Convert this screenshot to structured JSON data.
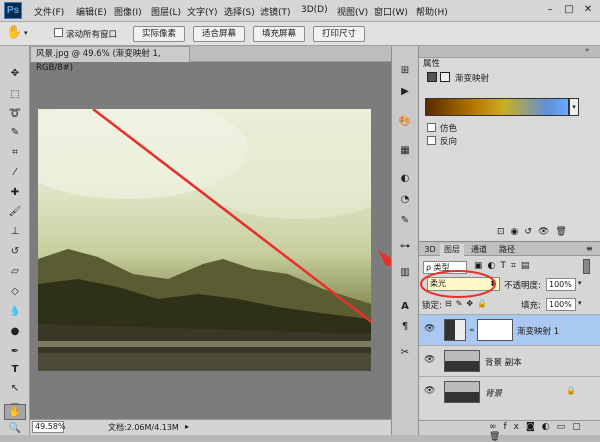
{
  "app": {
    "logo": "Ps"
  },
  "menus": [
    "文件(F)",
    "编辑(E)",
    "图像(I)",
    "图层(L)",
    "文字(Y)",
    "选择(S)",
    "滤镜(T)",
    "3D(D)",
    "视图(V)",
    "窗口(W)",
    "帮助(H)"
  ],
  "options": {
    "scroll_all_label": "滚动所有窗口",
    "buttons": [
      "实际像素",
      "适合屏幕",
      "填充屏幕",
      "打印尺寸"
    ]
  },
  "document": {
    "tab_title": "风景.jpg @ 49.6% (渐变映射 1, RGB/8#)",
    "zoom": "49.58%",
    "doc_size": "文档:2.06M/4.13M"
  },
  "properties": {
    "panel_title": "属性",
    "adjust_name": "渐变映射",
    "dither_label": "仿色",
    "reverse_label": "反向"
  },
  "layers_panel": {
    "tabs": [
      "3D",
      "图层",
      "通道",
      "路径"
    ],
    "kind_label": "类型",
    "blend_mode": "柔光",
    "opacity_label": "不透明度:",
    "opacity_value": "100%",
    "lock_label": "锁定:",
    "fill_label": "填充:",
    "fill_value": "100%",
    "layers": [
      {
        "name": "渐变映射 1",
        "selected": true
      },
      {
        "name": "背景 副本",
        "selected": false
      },
      {
        "name": "背景",
        "selected": false
      }
    ]
  },
  "colors": {
    "accent_red": "#e8302a",
    "selection_blue": "#a9c9f2"
  }
}
